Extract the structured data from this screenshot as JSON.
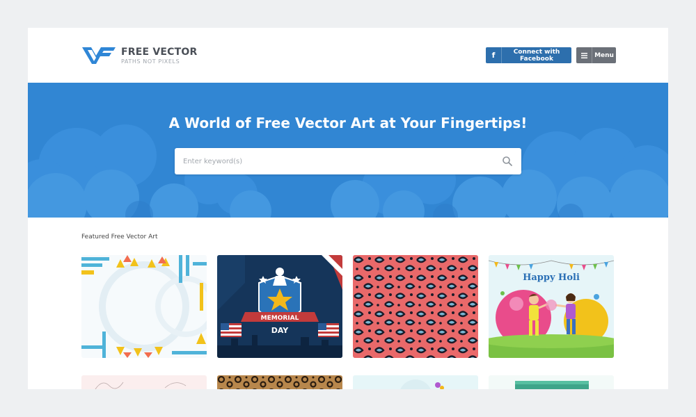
{
  "header": {
    "brand_name": "FREE VECTOR",
    "brand_tagline": "PATHS NOT PIXELS",
    "facebook_icon": "f",
    "facebook_label": "Connect with Facebook",
    "menu_label": "Menu"
  },
  "hero": {
    "title": "A World of Free Vector Art at Your Fingertips!",
    "search_placeholder": "Enter keyword(s)"
  },
  "featured": {
    "title": "Featured Free Vector Art",
    "items": [
      {
        "name": "geometric-frame-vector"
      },
      {
        "name": "memorial-day-vector",
        "banner_text": "MEMORIAL",
        "day_text": "DAY"
      },
      {
        "name": "leopard-pattern-vector"
      },
      {
        "name": "happy-holi-vector",
        "heading": "Happy Holi"
      }
    ]
  },
  "colors": {
    "accent": "#3186d3",
    "facebook": "#2d6fad",
    "menu": "#6b7078"
  }
}
